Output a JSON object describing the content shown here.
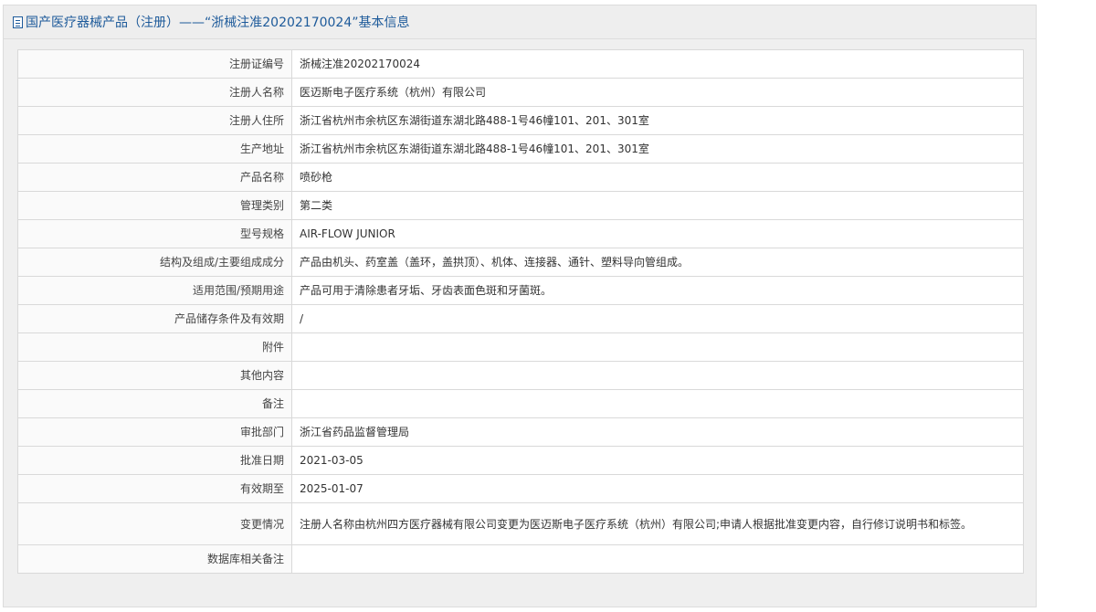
{
  "header": {
    "title": "国产医疗器械产品（注册）——“浙械注准20202170024”基本信息",
    "icon": "document-icon"
  },
  "rows": [
    {
      "label": "注册证编号",
      "value": "浙械注准20202170024"
    },
    {
      "label": "注册人名称",
      "value": "医迈斯电子医疗系统（杭州）有限公司"
    },
    {
      "label": "注册人住所",
      "value": "浙江省杭州市余杭区东湖街道东湖北路488-1号46幢101、201、301室"
    },
    {
      "label": "生产地址",
      "value": "浙江省杭州市余杭区东湖街道东湖北路488-1号46幢101、201、301室"
    },
    {
      "label": "产品名称",
      "value": "喷砂枪"
    },
    {
      "label": "管理类别",
      "value": "第二类"
    },
    {
      "label": "型号规格",
      "value": "AIR-FLOW JUNIOR"
    },
    {
      "label": "结构及组成/主要组成成分",
      "value": "产品由机头、药室盖（盖环，盖拱顶）、机体、连接器、通针、塑料导向管组成。"
    },
    {
      "label": "适用范围/预期用途",
      "value": "产品可用于清除患者牙垢、牙齿表面色斑和牙菌斑。"
    },
    {
      "label": "产品储存条件及有效期",
      "value": "/"
    },
    {
      "label": "附件",
      "value": ""
    },
    {
      "label": "其他内容",
      "value": ""
    },
    {
      "label": "备注",
      "value": ""
    },
    {
      "label": "审批部门",
      "value": "浙江省药品监督管理局"
    },
    {
      "label": "批准日期",
      "value": "2021-03-05"
    },
    {
      "label": "有效期至",
      "value": "2025-01-07"
    },
    {
      "label": "变更情况",
      "value": "注册人名称由杭州四方医疗器械有限公司变更为医迈斯电子医疗系统（杭州）有限公司;申请人根据批准变更内容，自行修订说明书和标签。"
    },
    {
      "label": "数据库相关备注",
      "value": ""
    }
  ]
}
